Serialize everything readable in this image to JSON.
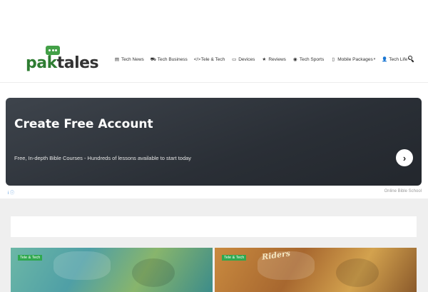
{
  "header": {
    "logo": {
      "pak": "pak",
      "tales": "tales"
    },
    "nav": [
      {
        "icon": "news-icon",
        "glyph": "▤",
        "label": "Tech News",
        "dropdown": false
      },
      {
        "icon": "car-icon",
        "glyph": "⛟",
        "label": "Tech Business",
        "dropdown": false
      },
      {
        "icon": "code-icon",
        "glyph": "</>",
        "label": "Tele & Tech",
        "dropdown": false
      },
      {
        "icon": "monitor-icon",
        "glyph": "▭",
        "label": "Devices",
        "dropdown": false
      },
      {
        "icon": "star-icon",
        "glyph": "★",
        "label": "Reviews",
        "dropdown": false
      },
      {
        "icon": "globe-icon",
        "glyph": "◉",
        "label": "Tech Sports",
        "dropdown": false
      },
      {
        "icon": "mobile-icon",
        "glyph": "▯",
        "label": "Mobile Packages",
        "dropdown": true
      },
      {
        "icon": "user-icon",
        "glyph": "👤",
        "label": "Tech Life",
        "dropdown": true
      }
    ]
  },
  "ad": {
    "title": "Create Free Account",
    "subtitle": "Free, In-depth Bible Courses - Hundreds of lessons available to start today",
    "source": "Online Bible School",
    "button_glyph": "›",
    "info_glyph": "i ⓘ"
  },
  "cards": [
    {
      "tag": "Tele & Tech"
    },
    {
      "tag": "Tele & Tech",
      "brand": "Riders"
    }
  ],
  "colors": {
    "brand_green": "#2e7d32",
    "tag_green": "#2fa84f",
    "ad_bg": "#2f343b"
  }
}
